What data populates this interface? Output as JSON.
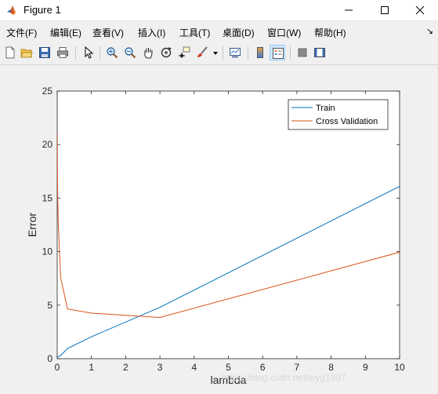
{
  "window": {
    "title": "Figure 1"
  },
  "menu": {
    "items": [
      {
        "label": "文件(F)",
        "name": "menu-file"
      },
      {
        "label": "编辑(E)",
        "name": "menu-edit"
      },
      {
        "label": "查看(V)",
        "name": "menu-view"
      },
      {
        "label": "插入(I)",
        "name": "menu-insert"
      },
      {
        "label": "工具(T)",
        "name": "menu-tools"
      },
      {
        "label": "桌面(D)",
        "name": "menu-desktop"
      },
      {
        "label": "窗口(W)",
        "name": "menu-window"
      },
      {
        "label": "帮助(H)",
        "name": "menu-help"
      }
    ],
    "dock_glyph": "↘"
  },
  "toolbar": {
    "buttons": [
      {
        "icon": "new-figure-icon"
      },
      {
        "icon": "open-file-icon"
      },
      {
        "icon": "save-icon"
      },
      {
        "icon": "print-icon"
      },
      {
        "icon": "pointer-icon"
      },
      {
        "icon": "zoom-in-icon"
      },
      {
        "icon": "zoom-out-icon"
      },
      {
        "icon": "pan-hand-icon"
      },
      {
        "icon": "rotate-3d-icon"
      },
      {
        "icon": "data-cursor-icon"
      },
      {
        "icon": "brush-icon"
      },
      {
        "icon": "link-plot-icon"
      },
      {
        "icon": "colorbar-icon"
      },
      {
        "icon": "legend-icon"
      },
      {
        "icon": "hide-plot-tools-icon"
      },
      {
        "icon": "show-plot-tools-icon"
      }
    ]
  },
  "colors": {
    "train": "#0072bd",
    "cross_validation": "#d95319",
    "axes_bg": "#ffffff",
    "figure_bg": "#f0f0f0"
  },
  "watermark": "https://blog.csdn.net/wyg1997",
  "chart_data": {
    "type": "line",
    "xlabel": "lambda",
    "ylabel": "Error",
    "xlim": [
      0,
      10
    ],
    "ylim": [
      0,
      25
    ],
    "xticks": [
      0,
      1,
      2,
      3,
      4,
      5,
      6,
      7,
      8,
      9,
      10
    ],
    "yticks": [
      0,
      5,
      10,
      15,
      20,
      25
    ],
    "grid": false,
    "legend_position": "top-right",
    "x": [
      0,
      0.001,
      0.003,
      0.01,
      0.03,
      0.1,
      0.3,
      1,
      3,
      10
    ],
    "series": [
      {
        "name": "Train",
        "color": "#0072bd",
        "values": [
          0.17,
          0.17,
          0.17,
          0.17,
          0.18,
          0.3,
          0.95,
          2.05,
          4.8,
          16.1
        ]
      },
      {
        "name": "Cross Validation",
        "color": "#d95319",
        "values": [
          17.0,
          17.3,
          21.0,
          16.0,
          12.8,
          7.6,
          4.65,
          4.25,
          3.85,
          9.95
        ]
      }
    ]
  }
}
